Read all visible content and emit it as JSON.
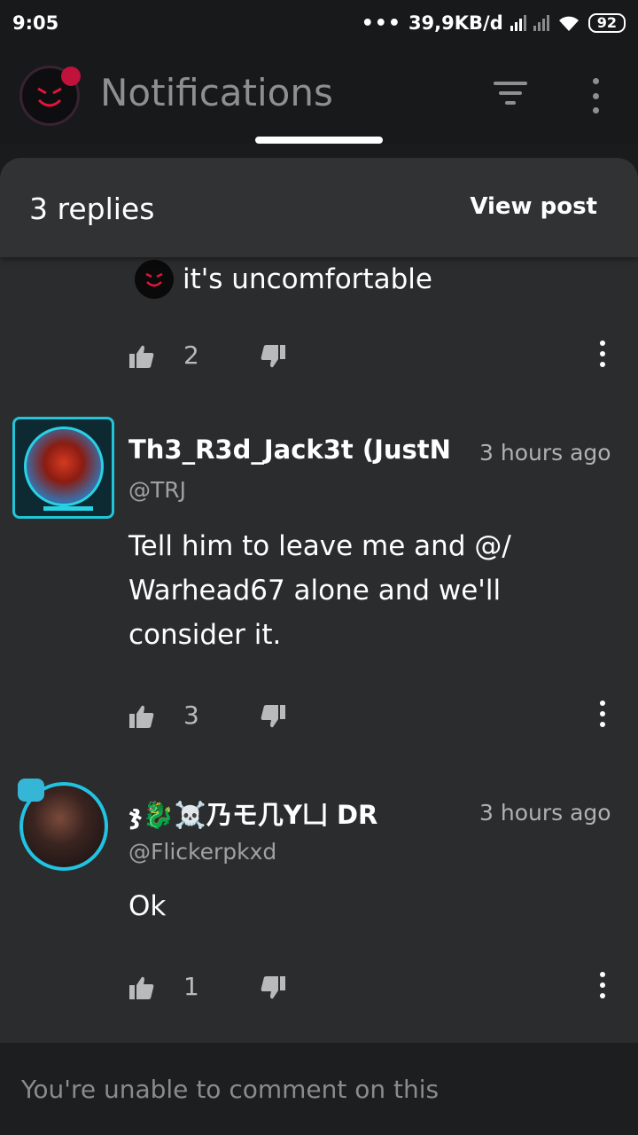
{
  "status_bar": {
    "time": "9:05",
    "dots": "•••",
    "speed": "39,9KB/d",
    "battery": "92"
  },
  "header": {
    "title": "Notifications",
    "avatar_icon": "angry-face-avatar"
  },
  "sheet": {
    "replies_count": "3 replies",
    "view_post": "View post"
  },
  "replies": [
    {
      "text": "it's uncomfortable",
      "likes": "2"
    },
    {
      "username": "Th3_R3d_Jack3t (JustN",
      "handle": "@TRJ",
      "time": "3 hours ago",
      "lines": [
        "Tell him to leave me and @/",
        "Warhead67 alone and we'll",
        "consider it."
      ],
      "likes": "3"
    },
    {
      "username": "ჯ🐉☠️乃モ几Y凵 DR",
      "handle": "@Flickerpkxd",
      "time": "3 hours ago",
      "lines": [
        "Ok"
      ],
      "likes": "1"
    }
  ],
  "footer": {
    "message": "You're unable to comment on this"
  },
  "colors": {
    "accent_cyan": "#22c4d8",
    "sheet_bg": "#2a2c2d",
    "header_bg": "#18191a"
  }
}
